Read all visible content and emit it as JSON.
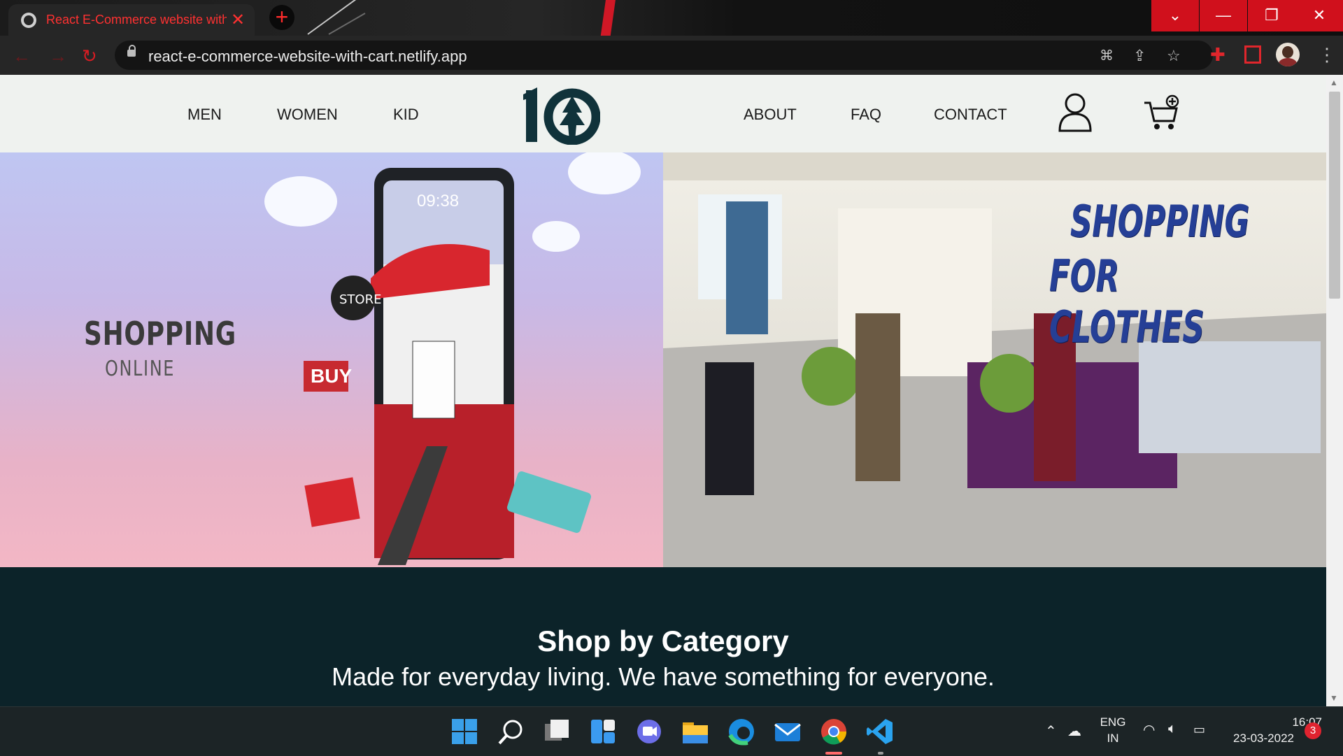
{
  "browser": {
    "tab_title": "React E-Commerce website with",
    "url": "react-e-commerce-website-with-cart.netlify.app",
    "accent_color": "#d0101c"
  },
  "site": {
    "nav_left": [
      "MEN",
      "WOMEN",
      "KID"
    ],
    "logo_text": "10",
    "nav_right": [
      "ABOUT",
      "FAQ",
      "CONTACT"
    ],
    "icons": [
      "user-icon",
      "cart-icon"
    ]
  },
  "hero": {
    "left_title": "SHOPPING",
    "left_subtitle": "ONLINE",
    "left_phone_time": "09:38",
    "left_store_sign": "STORE",
    "left_buy_sign": "BUY",
    "right_title_line1": "SHOPPING",
    "right_title_line2": "FOR CLOTHES"
  },
  "category": {
    "title": "Shop by Category",
    "subtitle": "Made for everyday living. We have something for everyone."
  },
  "taskbar": {
    "apps": [
      "start-icon",
      "search-icon",
      "task-view-icon",
      "widgets-icon",
      "teams-icon",
      "file-explorer-icon",
      "edge-icon",
      "mail-icon",
      "chrome-icon",
      "vscode-icon"
    ],
    "lang_line1": "ENG",
    "lang_line2": "IN",
    "time": "16:07",
    "date": "23-03-2022",
    "notifications": "3"
  }
}
